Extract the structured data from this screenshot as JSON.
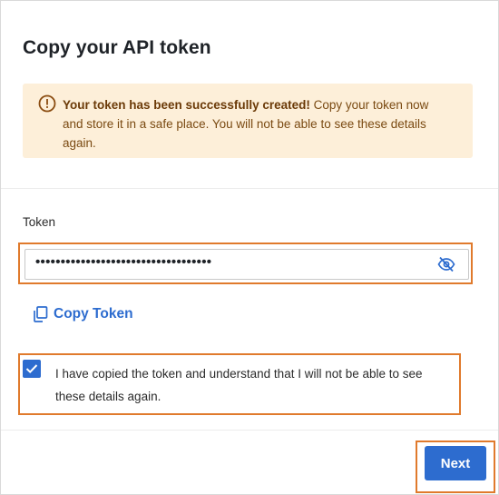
{
  "dialog": {
    "title": "Copy your API token"
  },
  "alert": {
    "icon": "warning-circle-icon",
    "strong_text": "Your token has been successfully created!",
    "line1_rest": " Copy your token now",
    "line2": "and store it in a safe place. You will not be able to see these details",
    "line3": "again.",
    "colors": {
      "background": "#fdefd9",
      "text": "#7a4a12",
      "icon": "#8a4b0f"
    }
  },
  "token": {
    "label": "Token",
    "value": "•••••••••••••••••••••••••••••••••••",
    "toggle_icon": "eye-slash-icon"
  },
  "copy": {
    "label": "Copy Token",
    "icon": "copy-icon"
  },
  "confirmation": {
    "checked": true,
    "line1": "I have copied the token and understand that I will not be able to see",
    "line2": "these details again."
  },
  "footer": {
    "next_label": "Next"
  },
  "theme": {
    "accent": "#2d6ccf",
    "highlight": "#e07a2c"
  }
}
